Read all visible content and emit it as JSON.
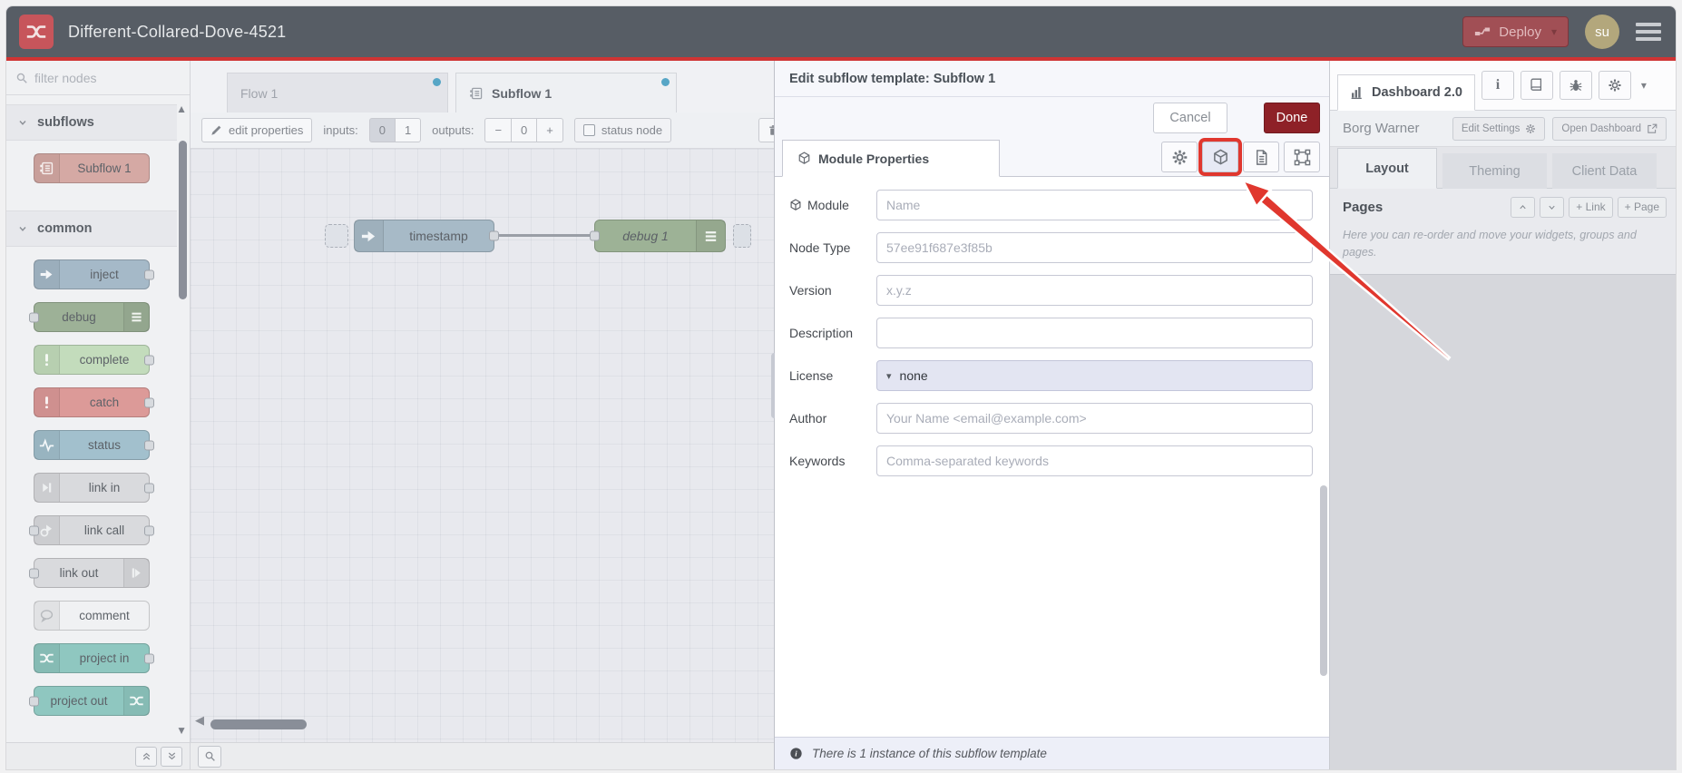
{
  "header": {
    "title": "Different-Collared-Dove-4521",
    "deploy_label": "Deploy",
    "avatar_text": "su"
  },
  "palette": {
    "filter_placeholder": "filter nodes",
    "categories": [
      {
        "label": "subflows",
        "items": [
          {
            "label": "Subflow 1",
            "color": "#d5a9a4",
            "icon": "subflow",
            "icon_side": "left",
            "icon_color": "#f6f0ef",
            "ports": []
          }
        ]
      },
      {
        "label": "common",
        "items": [
          {
            "label": "inject",
            "color": "#a5b9c8",
            "icon": "inject",
            "icon_side": "left",
            "icon_color": "#f4f6f8",
            "ports": [
              "out"
            ]
          },
          {
            "label": "debug",
            "color": "#9db197",
            "icon": "debuglist",
            "icon_side": "right",
            "icon_color": "#f2f5f1",
            "ports": [
              "in"
            ]
          },
          {
            "label": "complete",
            "color": "#c3dcbc",
            "icon": "exclaim",
            "icon_side": "left",
            "icon_color": "#f6faf5",
            "ports": [
              "out"
            ]
          },
          {
            "label": "catch",
            "color": "#dc9a98",
            "icon": "exclaim",
            "icon_side": "left",
            "icon_color": "#faf3f3",
            "ports": [
              "out"
            ]
          },
          {
            "label": "status",
            "color": "#a2c0cd",
            "icon": "status",
            "icon_side": "left",
            "icon_color": "#f3f7f9",
            "ports": [
              "out"
            ]
          },
          {
            "label": "link in",
            "color": "#d9dadd",
            "icon": "linkin",
            "icon_side": "left",
            "icon_color": "#eef0f1",
            "ports": [
              "out"
            ]
          },
          {
            "label": "link call",
            "color": "#d9dadd",
            "icon": "linkcall",
            "icon_side": "left",
            "icon_color": "#eef0f1",
            "ports": [
              "in",
              "out"
            ]
          },
          {
            "label": "link out",
            "color": "#d9dadd",
            "icon": "linkout",
            "icon_side": "right",
            "icon_color": "#eef0f1",
            "ports": [
              "in"
            ]
          },
          {
            "label": "comment",
            "color": "#f0f1f3",
            "icon": "comment",
            "icon_side": "left",
            "icon_color": "#b5b8bc",
            "ports": []
          },
          {
            "label": "project in",
            "color": "#8fc7c0",
            "icon": "nrlogo",
            "icon_side": "left",
            "icon_color": "#f2f8f7",
            "ports": [
              "out"
            ]
          },
          {
            "label": "project out",
            "color": "#8fc7c0",
            "icon": "nrlogo",
            "icon_side": "right",
            "icon_color": "#f2f8f7",
            "ports": [
              "in"
            ]
          }
        ]
      }
    ]
  },
  "workspace": {
    "tabs": [
      {
        "label": "Flow 1",
        "active": false,
        "unsaved": true
      },
      {
        "label": "Subflow 1",
        "active": true,
        "unsaved": true,
        "icon": "subflow"
      }
    ],
    "toolbar": {
      "edit_properties": "edit properties",
      "inputs_label": "inputs:",
      "inputs_buttons": [
        "0",
        "1"
      ],
      "inputs_active_index": 0,
      "outputs_label": "outputs:",
      "outputs_buttons": [
        "−",
        "0",
        "+"
      ],
      "status_node_label": "status node"
    },
    "nodes": [
      {
        "label": "timestamp",
        "color": "#a7bac7",
        "icon": "inject",
        "icon_side": "left",
        "italic": false,
        "ports": [
          "out"
        ]
      },
      {
        "label": "debug 1",
        "color": "#9db296",
        "icon": "debuglist",
        "icon_side": "right",
        "italic": true,
        "ports": [
          "in"
        ]
      }
    ]
  },
  "dialog": {
    "title": "Edit subflow template: Subflow 1",
    "cancel_label": "Cancel",
    "done_label": "Done",
    "tab_label": "Module Properties",
    "fields": [
      {
        "label": "Module",
        "icon": "cube",
        "type": "input",
        "placeholder": "Name",
        "value": ""
      },
      {
        "label": "Node Type",
        "type": "input",
        "placeholder": "57ee91f687e3f85b",
        "value": ""
      },
      {
        "label": "Version",
        "type": "input",
        "placeholder": "x.y.z",
        "value": ""
      },
      {
        "label": "Description",
        "type": "input",
        "placeholder": "",
        "value": ""
      },
      {
        "label": "License",
        "type": "select",
        "value": "none"
      },
      {
        "label": "Author",
        "type": "input",
        "placeholder": "Your Name <email@example.com>",
        "value": ""
      },
      {
        "label": "Keywords",
        "type": "input",
        "placeholder": "Comma-separated keywords",
        "value": ""
      }
    ],
    "footer_note": "There is 1 instance of this subflow template"
  },
  "sidebar": {
    "dashboard_tab": "Dashboard 2.0",
    "owner": "Borg Warner",
    "edit_settings_label": "Edit Settings",
    "open_dashboard_label": "Open Dashboard",
    "tabs": [
      {
        "label": "Layout",
        "active": true
      },
      {
        "label": "Theming",
        "active": false
      },
      {
        "label": "Client Data",
        "active": false
      }
    ],
    "pages_title": "Pages",
    "add_link_label": "+ Link",
    "add_page_label": "+ Page",
    "pages_help": "Here you can re-order and move your widgets, groups and pages."
  },
  "icons": {
    "caret_down": "▾",
    "scroll_up": "▲",
    "scroll_down": "▼",
    "scroll_left": "◀"
  },
  "colors": {
    "accent_red_line": "#cf3434",
    "deploy_button": "#a14f55",
    "done_button": "#8e2127",
    "highlight_annotation": "#e0372e",
    "unsaved_dot": "#57a6c6",
    "avatar": "#b3a77c"
  }
}
